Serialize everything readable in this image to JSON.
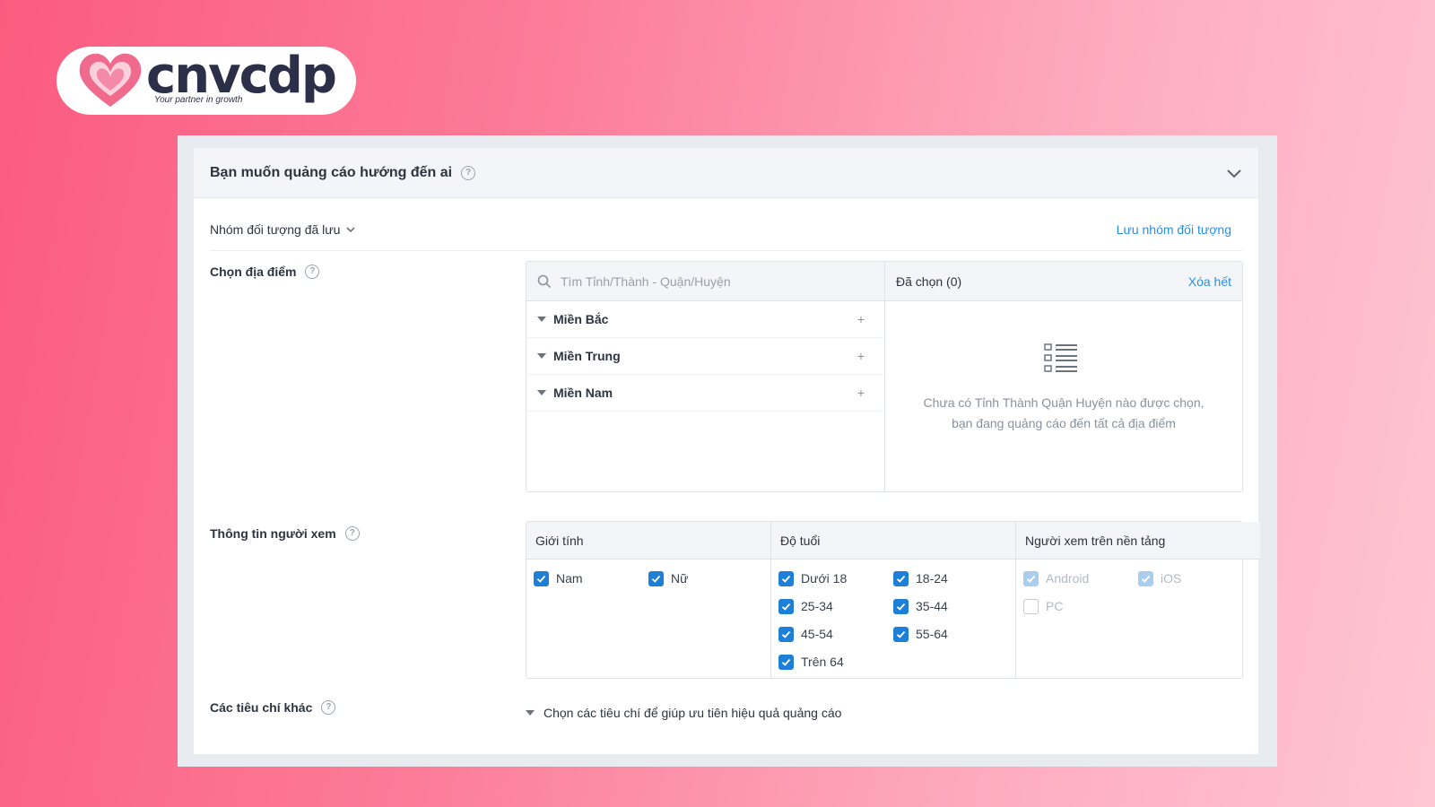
{
  "logo": {
    "wordmark": "cnvcdp",
    "tagline": "Your partner in growth",
    "heart_colors": [
      "#f9a8bf",
      "#f06a8e"
    ]
  },
  "panel": {
    "title": "Bạn muốn quảng cáo hướng đến ai",
    "help_icon": "question-circle-icon",
    "collapse_icon": "chevron-down-icon"
  },
  "saved_group": {
    "label": "Nhóm đối tượng đã lưu",
    "save_link": "Lưu nhóm đối tượng"
  },
  "location": {
    "label": "Chọn địa điểm",
    "search_placeholder": "Tìm Tỉnh/Thành - Quận/Huyện",
    "regions": [
      {
        "name": "Miền Bắc"
      },
      {
        "name": "Miền Trung"
      },
      {
        "name": "Miền Nam"
      }
    ],
    "selected_title": "Đã chọn (0)",
    "clear_all": "Xóa hết",
    "empty_message": "Chưa có Tỉnh Thành Quận Huyện nào được chọn, bạn đang quảng cáo đến tất cả địa điểm"
  },
  "viewer_info": {
    "label": "Thông tin người xem",
    "gender": {
      "title": "Giới tính",
      "options": [
        {
          "label": "Nam",
          "checked": true
        },
        {
          "label": "Nữ",
          "checked": true
        }
      ]
    },
    "age": {
      "title": "Độ tuổi",
      "options": [
        {
          "label": "Dưới 18",
          "checked": true
        },
        {
          "label": "18-24",
          "checked": true
        },
        {
          "label": "25-34",
          "checked": true
        },
        {
          "label": "35-44",
          "checked": true
        },
        {
          "label": "45-54",
          "checked": true
        },
        {
          "label": "55-64",
          "checked": true
        },
        {
          "label": "Trên 64",
          "checked": true
        }
      ]
    },
    "platform": {
      "title": "Người xem trên nền tảng",
      "options": [
        {
          "label": "Android",
          "checked": true,
          "disabled": true
        },
        {
          "label": "iOS",
          "checked": true,
          "disabled": true
        },
        {
          "label": "PC",
          "checked": false,
          "disabled": true
        }
      ]
    }
  },
  "other_criteria": {
    "label": "Các tiêu chí khác",
    "toggle_text": "Chọn các tiêu chí để giúp ưu tiên hiệu quả quảng cáo"
  }
}
